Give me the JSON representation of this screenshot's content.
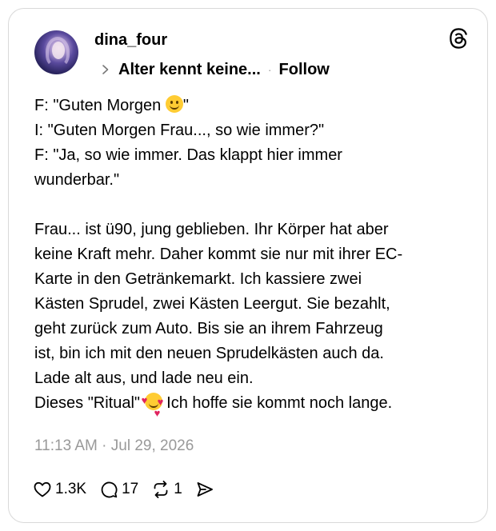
{
  "post": {
    "username": "dina_four",
    "topic": "Alter kennt keine...",
    "separator": "·",
    "follow_label": "Follow",
    "lines": {
      "l1_a": "F: \"Guten Morgen ",
      "l1_b": "\"",
      "l2": "I: \"Guten Morgen Frau..., so wie immer?\"",
      "l3": "F: \"Ja, so wie immer. Das klappt hier immer",
      "l4": "wunderbar.\"",
      "l5": "Frau... ist ü90, jung geblieben. Ihr Körper hat aber",
      "l6": "keine Kraft mehr. Daher kommt sie nur mit ihrer EC-",
      "l7": "Karte in den Getränkemarkt. Ich kassiere zwei",
      "l8": "Kästen Sprudel, zwei Kästen Leergut. Sie bezahlt,",
      "l9": "geht zurück zum Auto. Bis sie an ihrem Fahrzeug",
      "l10": "ist, bin ich mit den neuen Sprudelkästen auch da.",
      "l11": "Lade alt aus, und lade neu ein.",
      "l12_a": "Dieses \"Ritual\" ",
      "l12_b": " Ich hoffe sie kommt noch lange."
    },
    "emojis": [
      "slightly-smiling-face-emoji",
      "smiling-face-with-hearts-emoji"
    ],
    "timestamp": "11:13 AM · Jul 29, 2026",
    "actions": {
      "likes": "1.3K",
      "replies": "17",
      "reposts": "1"
    }
  },
  "icons": [
    "threads-logo-icon",
    "chevron-right-icon",
    "heart-icon",
    "comment-icon",
    "repost-icon",
    "share-icon"
  ],
  "colors": {
    "text": "#000000",
    "muted": "#999999",
    "border": "#d9d9d9"
  }
}
